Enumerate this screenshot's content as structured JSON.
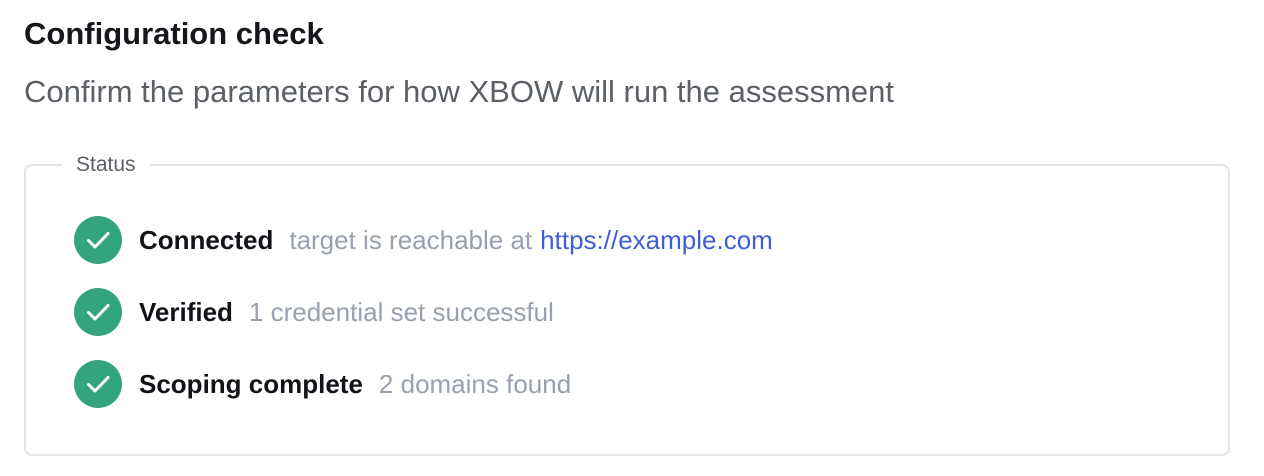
{
  "header": {
    "title": "Configuration check",
    "subtitle": "Confirm the parameters for how XBOW will run the assessment"
  },
  "status": {
    "legend": "Status",
    "items": [
      {
        "title": "Connected",
        "detail": "target is reachable at",
        "link": "https://example.com",
        "icon": "check-circle-icon",
        "state": "success"
      },
      {
        "title": "Verified",
        "detail": "1 credential set successful",
        "icon": "check-circle-icon",
        "state": "success"
      },
      {
        "title": "Scoping complete",
        "detail": "2 domains found",
        "icon": "check-circle-icon",
        "state": "success"
      }
    ]
  },
  "colors": {
    "success": "#34a47f",
    "link": "#3d5ed6",
    "muted": "#98a0ad",
    "border": "#e3e4e7"
  }
}
